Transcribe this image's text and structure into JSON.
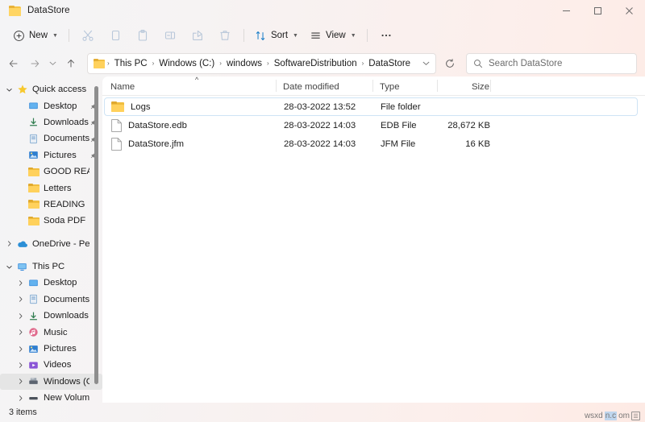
{
  "window": {
    "tab_title": "DataStore",
    "folder_icon": "folder-icon",
    "controls": {
      "minimize": "minimize-icon",
      "maximize": "maximize-icon",
      "close": "close-icon"
    }
  },
  "toolbar": {
    "new_label": "New",
    "sort_label": "Sort",
    "view_label": "View",
    "more_label": "•••",
    "icons": [
      {
        "name": "cut-icon",
        "title": "Cut"
      },
      {
        "name": "copy-icon",
        "title": "Copy"
      },
      {
        "name": "paste-icon",
        "title": "Paste"
      },
      {
        "name": "rename-icon",
        "title": "Rename"
      },
      {
        "name": "share-icon",
        "title": "Share"
      },
      {
        "name": "delete-icon",
        "title": "Delete"
      }
    ]
  },
  "addressbar": {
    "back": "back-arrow-icon",
    "forward": "forward-arrow-icon",
    "recent": "chevron-down-icon",
    "up": "up-arrow-icon",
    "refresh": "refresh-icon",
    "crumbs": [
      "This PC",
      "Windows (C:)",
      "windows",
      "SoftwareDistribution",
      "DataStore"
    ],
    "separator": "›"
  },
  "search": {
    "placeholder": "Search DataStore",
    "icon": "search-icon"
  },
  "sidebar": {
    "items": [
      {
        "label": "Quick access",
        "icon": "star-icon",
        "chevron": "open",
        "indent": 0,
        "pinned": false,
        "selected": false
      },
      {
        "label": "Desktop",
        "icon": "desktop-icon",
        "chevron": "none",
        "indent": 1,
        "pinned": true,
        "selected": false
      },
      {
        "label": "Downloads",
        "icon": "downloads-icon",
        "chevron": "none",
        "indent": 1,
        "pinned": true,
        "selected": false
      },
      {
        "label": "Documents",
        "icon": "documents-icon",
        "chevron": "none",
        "indent": 1,
        "pinned": true,
        "selected": false
      },
      {
        "label": "Pictures",
        "icon": "pictures-icon",
        "chevron": "none",
        "indent": 1,
        "pinned": true,
        "selected": false
      },
      {
        "label": "GOOD READ",
        "icon": "folder-icon",
        "chevron": "none",
        "indent": 1,
        "pinned": false,
        "selected": false
      },
      {
        "label": "Letters",
        "icon": "folder-icon",
        "chevron": "none",
        "indent": 1,
        "pinned": false,
        "selected": false
      },
      {
        "label": "READING",
        "icon": "folder-icon",
        "chevron": "none",
        "indent": 1,
        "pinned": false,
        "selected": false
      },
      {
        "label": "Soda PDF",
        "icon": "folder-icon",
        "chevron": "none",
        "indent": 1,
        "pinned": false,
        "selected": false
      },
      {
        "label": "OneDrive - Persona",
        "icon": "onedrive-icon",
        "chevron": "closed",
        "indent": 0,
        "pinned": false,
        "selected": false,
        "gap_before": true
      },
      {
        "label": "This PC",
        "icon": "pc-icon",
        "chevron": "open",
        "indent": 0,
        "pinned": false,
        "selected": false,
        "gap_before": true
      },
      {
        "label": "Desktop",
        "icon": "desktop-icon",
        "chevron": "closed",
        "indent": 1,
        "pinned": false,
        "selected": false
      },
      {
        "label": "Documents",
        "icon": "documents-icon",
        "chevron": "closed",
        "indent": 1,
        "pinned": false,
        "selected": false
      },
      {
        "label": "Downloads",
        "icon": "downloads-icon",
        "chevron": "closed",
        "indent": 1,
        "pinned": false,
        "selected": false
      },
      {
        "label": "Music",
        "icon": "music-icon",
        "chevron": "closed",
        "indent": 1,
        "pinned": false,
        "selected": false
      },
      {
        "label": "Pictures",
        "icon": "pictures-icon",
        "chevron": "closed",
        "indent": 1,
        "pinned": false,
        "selected": false
      },
      {
        "label": "Videos",
        "icon": "videos-icon",
        "chevron": "closed",
        "indent": 1,
        "pinned": false,
        "selected": false
      },
      {
        "label": "Windows (C:)",
        "icon": "drive-icon",
        "chevron": "closed",
        "indent": 1,
        "pinned": false,
        "selected": true
      },
      {
        "label": "New Volume (D:)",
        "icon": "drive-plain-icon",
        "chevron": "closed",
        "indent": 1,
        "pinned": false,
        "selected": false
      }
    ]
  },
  "filelist": {
    "columns": [
      "Name",
      "Date modified",
      "Type",
      "Size"
    ],
    "sort_column": "Name",
    "sort_direction": "ascending",
    "rows": [
      {
        "name": "Logs",
        "date": "28-03-2022 13:52",
        "type": "File folder",
        "size": "",
        "icon": "folder-icon",
        "focused": true
      },
      {
        "name": "DataStore.edb",
        "date": "28-03-2022 14:03",
        "type": "EDB File",
        "size": "28,672 KB",
        "icon": "file-icon",
        "focused": false
      },
      {
        "name": "DataStore.jfm",
        "date": "28-03-2022 14:03",
        "type": "JFM File",
        "size": "16 KB",
        "icon": "file-icon",
        "focused": false
      }
    ]
  },
  "statusbar": {
    "item_count": "3 items"
  },
  "watermark": {
    "text_before": "wsxd",
    "text_highlight": "n.c",
    "text_after": "om",
    "badge": "☰"
  },
  "colors": {
    "accent_blue": "#0067c0",
    "folder_yellow": "#ffd15c",
    "star_gold": "#f7c92e",
    "selection_border": "#cfe4f5",
    "nav_selected": "#e5e5e5"
  }
}
